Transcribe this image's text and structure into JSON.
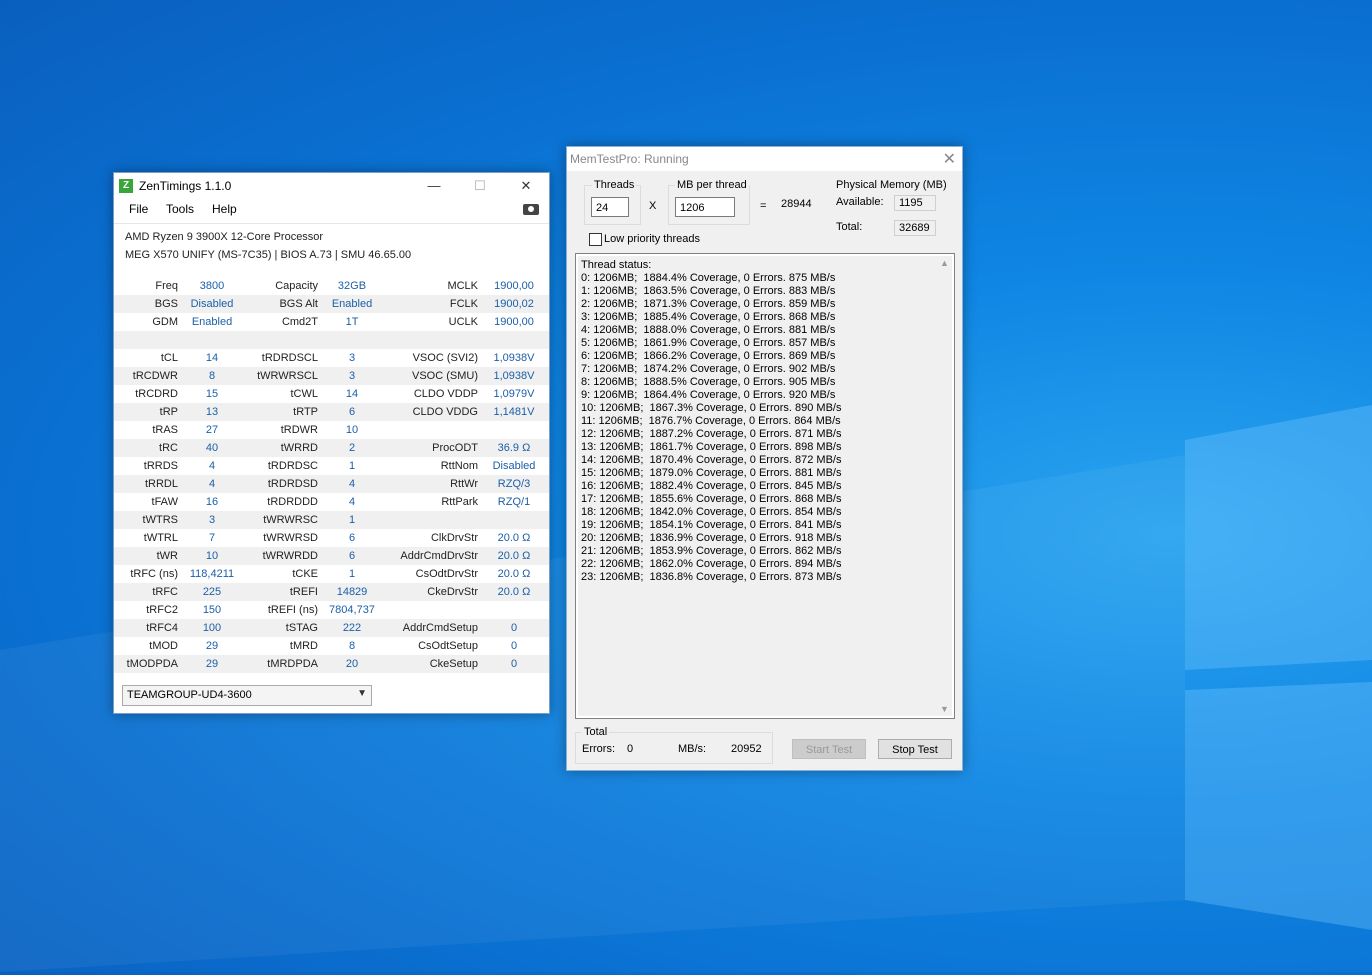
{
  "zentimings": {
    "title": "ZenTimings 1.1.0",
    "icon_letter": "Z",
    "window_controls": {
      "minimize": "—",
      "maximize": "☐",
      "close": "✕"
    },
    "menu": [
      "File",
      "Tools",
      "Help"
    ],
    "cpu": "AMD Ryzen 9 3900X 12-Core Processor",
    "board": "MEG X570 UNIFY (MS-7C35) | BIOS A.73 | SMU 46.65.00",
    "rows": [
      [
        "Freq",
        "3800",
        "Capacity",
        "32GB",
        "MCLK",
        "1900,00"
      ],
      [
        "BGS",
        "Disabled",
        "BGS Alt",
        "Enabled",
        "FCLK",
        "1900,02"
      ],
      [
        "GDM",
        "Enabled",
        "Cmd2T",
        "1T",
        "UCLK",
        "1900,00"
      ],
      [
        "",
        "",
        "",
        "",
        "",
        ""
      ],
      [
        "tCL",
        "14",
        "tRDRDSCL",
        "3",
        "VSOC (SVI2)",
        "1,0938V"
      ],
      [
        "tRCDWR",
        "8",
        "tWRWRSCL",
        "3",
        "VSOC (SMU)",
        "1,0938V"
      ],
      [
        "tRCDRD",
        "15",
        "tCWL",
        "14",
        "CLDO VDDP",
        "1,0979V"
      ],
      [
        "tRP",
        "13",
        "tRTP",
        "6",
        "CLDO VDDG",
        "1,1481V"
      ],
      [
        "tRAS",
        "27",
        "tRDWR",
        "10",
        "",
        ""
      ],
      [
        "tRC",
        "40",
        "tWRRD",
        "2",
        "ProcODT",
        "36.9 Ω"
      ],
      [
        "tRRDS",
        "4",
        "tRDRDSC",
        "1",
        "RttNom",
        "Disabled"
      ],
      [
        "tRRDL",
        "4",
        "tRDRDSD",
        "4",
        "RttWr",
        "RZQ/3"
      ],
      [
        "tFAW",
        "16",
        "tRDRDDD",
        "4",
        "RttPark",
        "RZQ/1"
      ],
      [
        "tWTRS",
        "3",
        "tWRWRSC",
        "1",
        "",
        ""
      ],
      [
        "tWTRL",
        "7",
        "tWRWRSD",
        "6",
        "ClkDrvStr",
        "20.0 Ω"
      ],
      [
        "tWR",
        "10",
        "tWRWRDD",
        "6",
        "AddrCmdDrvStr",
        "20.0 Ω"
      ],
      [
        "tRFC (ns)",
        "118,4211",
        "tCKE",
        "1",
        "CsOdtDrvStr",
        "20.0 Ω"
      ],
      [
        "tRFC",
        "225",
        "tREFI",
        "14829",
        "CkeDrvStr",
        "20.0 Ω"
      ],
      [
        "tRFC2",
        "150",
        "tREFI (ns)",
        "7804,737",
        "",
        ""
      ],
      [
        "tRFC4",
        "100",
        "tSTAG",
        "222",
        "AddrCmdSetup",
        "0"
      ],
      [
        "tMOD",
        "29",
        "tMRD",
        "8",
        "CsOdtSetup",
        "0"
      ],
      [
        "tMODPDA",
        "29",
        "tMRDPDA",
        "20",
        "CkeSetup",
        "0"
      ]
    ],
    "module_select": "TEAMGROUP-UD4-3600"
  },
  "memtest": {
    "title": "MemTestPro: Running",
    "threads_label": "Threads",
    "threads_value": "24",
    "times": "X",
    "mb_label": "MB per thread",
    "mb_value": "1206",
    "equals": "=",
    "total_mb": "28944",
    "phys_label": "Physical Memory (MB)",
    "available_label": "Available:",
    "available_value": "1195",
    "total_label": "Total:",
    "total_value": "32689",
    "low_priority_label": "Low priority threads",
    "status_header": "Thread status:",
    "threads": [
      "0: 1206MB;  1884.4% Coverage, 0 Errors. 875 MB/s",
      "1: 1206MB;  1863.5% Coverage, 0 Errors. 883 MB/s",
      "2: 1206MB;  1871.3% Coverage, 0 Errors. 859 MB/s",
      "3: 1206MB;  1885.4% Coverage, 0 Errors. 868 MB/s",
      "4: 1206MB;  1888.0% Coverage, 0 Errors. 881 MB/s",
      "5: 1206MB;  1861.9% Coverage, 0 Errors. 857 MB/s",
      "6: 1206MB;  1866.2% Coverage, 0 Errors. 869 MB/s",
      "7: 1206MB;  1874.2% Coverage, 0 Errors. 902 MB/s",
      "8: 1206MB;  1888.5% Coverage, 0 Errors. 905 MB/s",
      "9: 1206MB;  1864.4% Coverage, 0 Errors. 920 MB/s",
      "10: 1206MB;  1867.3% Coverage, 0 Errors. 890 MB/s",
      "11: 1206MB;  1876.7% Coverage, 0 Errors. 864 MB/s",
      "12: 1206MB;  1887.2% Coverage, 0 Errors. 871 MB/s",
      "13: 1206MB;  1861.7% Coverage, 0 Errors. 898 MB/s",
      "14: 1206MB;  1870.4% Coverage, 0 Errors. 872 MB/s",
      "15: 1206MB;  1879.0% Coverage, 0 Errors. 881 MB/s",
      "16: 1206MB;  1882.4% Coverage, 0 Errors. 845 MB/s",
      "17: 1206MB;  1855.6% Coverage, 0 Errors. 868 MB/s",
      "18: 1206MB;  1842.0% Coverage, 0 Errors. 854 MB/s",
      "19: 1206MB;  1854.1% Coverage, 0 Errors. 841 MB/s",
      "20: 1206MB;  1836.9% Coverage, 0 Errors. 918 MB/s",
      "21: 1206MB;  1853.9% Coverage, 0 Errors. 862 MB/s",
      "22: 1206MB;  1862.0% Coverage, 0 Errors. 894 MB/s",
      "23: 1206MB;  1836.8% Coverage, 0 Errors. 873 MB/s"
    ],
    "total_group_label": "Total",
    "errors_label": "Errors:",
    "errors_value": "0",
    "mbs_label": "MB/s:",
    "mbs_value": "20952",
    "start_button": "Start Test",
    "stop_button": "Stop Test"
  },
  "colors": {
    "desktop": "#0f86e3",
    "zentimings_value": "#1c5fa8"
  }
}
